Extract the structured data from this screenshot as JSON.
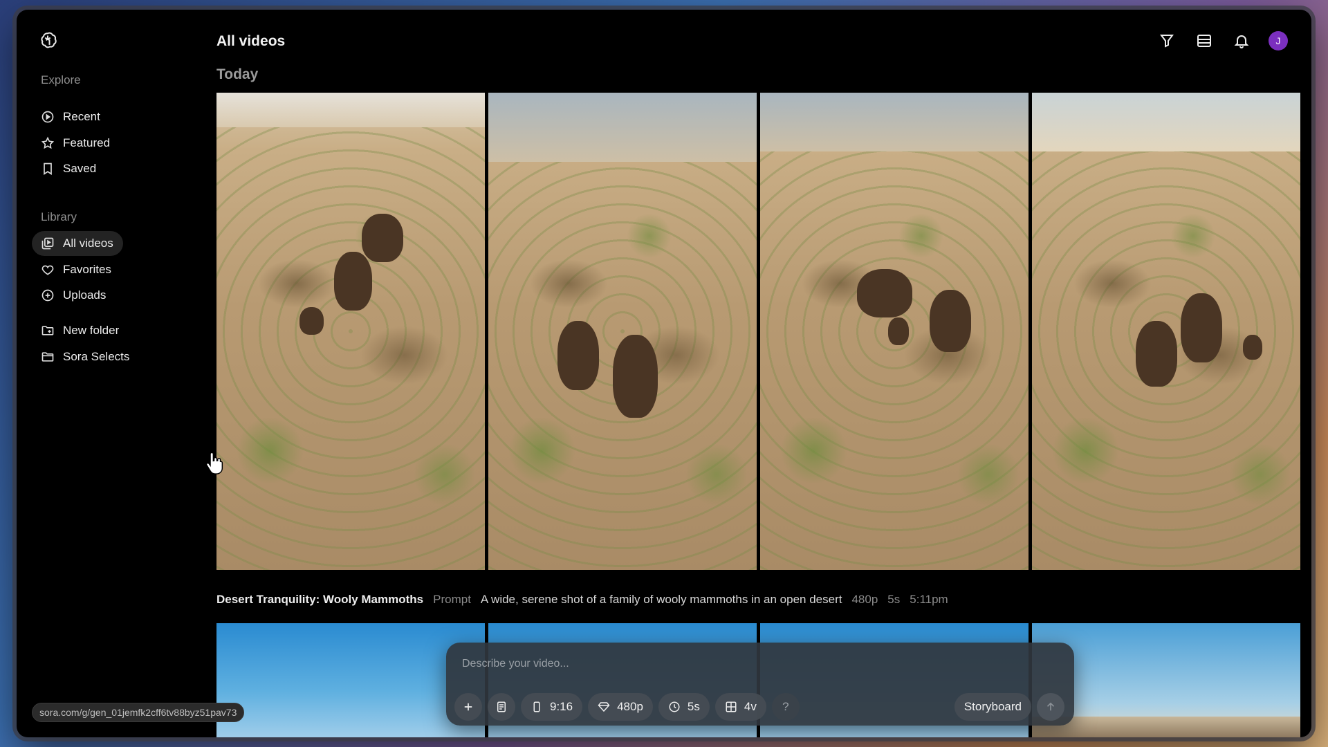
{
  "sidebar": {
    "explore_title": "Explore",
    "explore_items": [
      {
        "label": "Recent",
        "icon": "play-circle-icon"
      },
      {
        "label": "Featured",
        "icon": "star-icon"
      },
      {
        "label": "Saved",
        "icon": "bookmark-icon"
      }
    ],
    "library_title": "Library",
    "library_items": [
      {
        "label": "All videos",
        "icon": "videos-icon",
        "active": true
      },
      {
        "label": "Favorites",
        "icon": "heart-icon"
      },
      {
        "label": "Uploads",
        "icon": "plus-circle-icon"
      }
    ],
    "folders": [
      {
        "label": "New folder",
        "icon": "folder-plus-icon"
      },
      {
        "label": "Sora Selects",
        "icon": "folder-icon"
      }
    ]
  },
  "header": {
    "title": "All videos",
    "icons": [
      "filter-icon",
      "list-view-icon",
      "bell-icon"
    ],
    "avatar_initial": "J",
    "avatar_color": "#7b2fbf"
  },
  "feed": {
    "group_title": "Today",
    "video": {
      "title": "Desert Tranquility: Wooly Mammoths",
      "prompt_label": "Prompt",
      "prompt": "A wide, serene shot of a family of wooly mammoths in an open desert",
      "resolution": "480p",
      "duration": "5s",
      "time": "5:11pm"
    }
  },
  "composer": {
    "placeholder": "Describe your video...",
    "aspect_ratio": "9:16",
    "resolution": "480p",
    "duration": "5s",
    "variations": "4v",
    "help": "?",
    "storyboard_label": "Storyboard"
  },
  "status_url": "sora.com/g/gen_01jemfk2cff6tv88byz51pav73"
}
